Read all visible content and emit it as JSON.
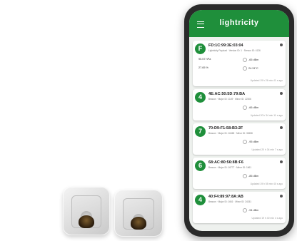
{
  "app": {
    "title": "lightricity"
  },
  "cards": [
    {
      "number": "F",
      "mac": "FD:1C:99:3E:03:04",
      "subtitle": "Lightricity Payload · Version ID: 1 · Sensor ID: 4126",
      "values": [
        "95.57 hPa",
        "-65 dBm",
        "27.65 %",
        "24.31°C"
      ],
      "updated": "Updated 19 h 26 min 41 s ago"
    },
    {
      "number": "4",
      "mac": "4E:AC:50:5D:79:BA",
      "subtitle": "Beacon · Major ID: 1149 · Minor ID: 22306",
      "values": [
        "-66 dBm"
      ],
      "updated": "Updated 20 h 34 min 11 s ago"
    },
    {
      "number": "7",
      "mac": "70:D9:F1:58:B3:2F",
      "subtitle": "Beacon · Major ID: 16465 · Minor ID: 30658",
      "values": [
        "-95 dBm"
      ],
      "updated": "Updated 20 h 34 min 7 s ago"
    },
    {
      "number": "6",
      "mac": "68:AC:80:56:8B:F6",
      "subtitle": "Beacon · Major ID: 16777 · Minor ID: 1661",
      "values": [
        "-85 dBm"
      ],
      "updated": "Updated 19 h 55 min 40 s ago"
    },
    {
      "number": "4",
      "mac": "40:F4:89:97:8A:AB",
      "subtitle": "Beacon · Major ID: 1661 · Minor ID: 24151",
      "values": [
        "-94 dBm"
      ],
      "updated": "Updated 19 h 40 min 4 s ago"
    }
  ]
}
